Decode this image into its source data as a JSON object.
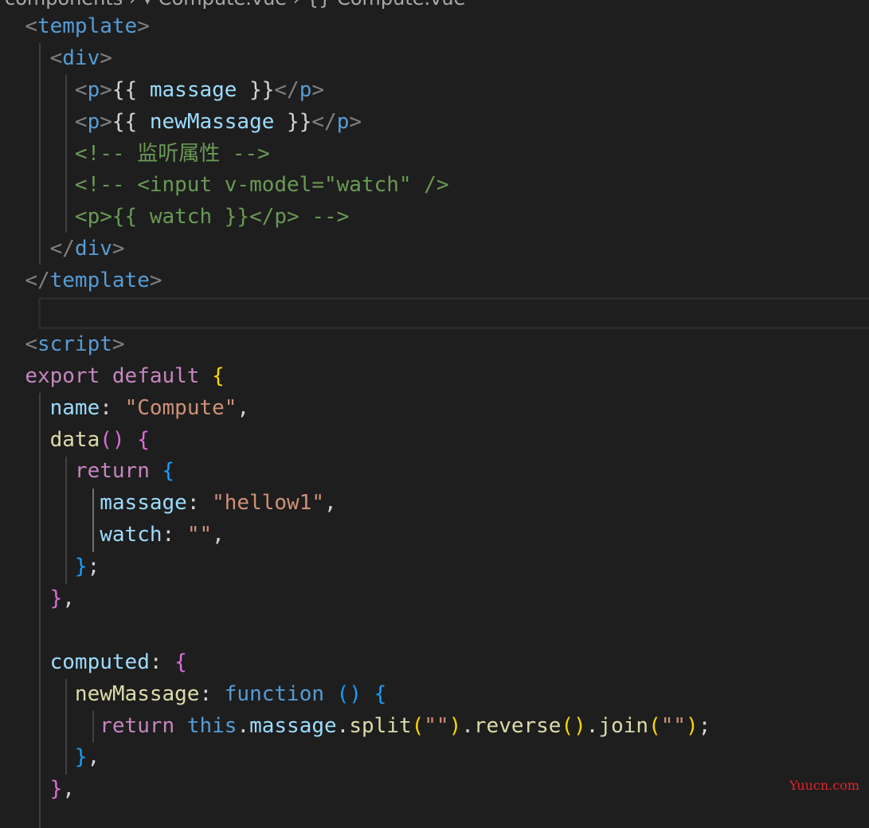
{
  "breadcrumb": {
    "text": "components › ▾ Compute.vue › {} Compute.vue"
  },
  "watermark": "Yuucn.com",
  "colors": {
    "background": "#1e1e1e",
    "tag": "#569cd6",
    "property": "#9cdcfe",
    "comment": "#6a9955",
    "keyword": "#c586c0",
    "string": "#ce9178",
    "function": "#dcdcaa",
    "bracket_gold": "#ffd700",
    "bracket_orchid": "#da70d6",
    "bracket_blue": "#179fff"
  },
  "code": {
    "lines": [
      [
        {
          "t": "  ",
          "c": "text"
        },
        {
          "t": "<",
          "c": "punct"
        },
        {
          "t": "template",
          "c": "tag"
        },
        {
          "t": ">",
          "c": "punct"
        }
      ],
      [
        {
          "t": "    ",
          "c": "text"
        },
        {
          "t": "<",
          "c": "punct"
        },
        {
          "t": "div",
          "c": "tag"
        },
        {
          "t": ">",
          "c": "punct"
        }
      ],
      [
        {
          "t": "      ",
          "c": "text"
        },
        {
          "t": "<",
          "c": "punct"
        },
        {
          "t": "p",
          "c": "tag"
        },
        {
          "t": ">",
          "c": "punct"
        },
        {
          "t": "{{ ",
          "c": "text"
        },
        {
          "t": "massage",
          "c": "var"
        },
        {
          "t": " }}",
          "c": "text"
        },
        {
          "t": "</",
          "c": "punct"
        },
        {
          "t": "p",
          "c": "tag"
        },
        {
          "t": ">",
          "c": "punct"
        }
      ],
      [
        {
          "t": "      ",
          "c": "text"
        },
        {
          "t": "<",
          "c": "punct"
        },
        {
          "t": "p",
          "c": "tag"
        },
        {
          "t": ">",
          "c": "punct"
        },
        {
          "t": "{{ ",
          "c": "text"
        },
        {
          "t": "newMassage",
          "c": "var"
        },
        {
          "t": " }}",
          "c": "text"
        },
        {
          "t": "</",
          "c": "punct"
        },
        {
          "t": "p",
          "c": "tag"
        },
        {
          "t": ">",
          "c": "punct"
        }
      ],
      [
        {
          "t": "      ",
          "c": "text"
        },
        {
          "t": "<!-- 监听属性 -->",
          "c": "cmt"
        }
      ],
      [
        {
          "t": "      ",
          "c": "text"
        },
        {
          "t": "<!-- <input v-model=\"watch\" />",
          "c": "cmt"
        }
      ],
      [
        {
          "t": "      ",
          "c": "text"
        },
        {
          "t": "<p>{{ watch }}</p> -->",
          "c": "cmt"
        }
      ],
      [
        {
          "t": "    ",
          "c": "text"
        },
        {
          "t": "</",
          "c": "punct"
        },
        {
          "t": "div",
          "c": "tag"
        },
        {
          "t": ">",
          "c": "punct"
        }
      ],
      [
        {
          "t": "  ",
          "c": "text"
        },
        {
          "t": "</",
          "c": "punct"
        },
        {
          "t": "template",
          "c": "tag"
        },
        {
          "t": ">",
          "c": "punct"
        }
      ],
      [],
      [
        {
          "t": "  ",
          "c": "text"
        },
        {
          "t": "<",
          "c": "punct"
        },
        {
          "t": "script",
          "c": "tag"
        },
        {
          "t": ">",
          "c": "punct"
        }
      ],
      [
        {
          "t": "  ",
          "c": "text"
        },
        {
          "t": "export",
          "c": "kw"
        },
        {
          "t": " ",
          "c": "text"
        },
        {
          "t": "default",
          "c": "kw"
        },
        {
          "t": " ",
          "c": "text"
        },
        {
          "t": "{",
          "c": "br1"
        }
      ],
      [
        {
          "t": "    ",
          "c": "text"
        },
        {
          "t": "name",
          "c": "var"
        },
        {
          "t": ": ",
          "c": "text"
        },
        {
          "t": "\"Compute\"",
          "c": "str"
        },
        {
          "t": ",",
          "c": "text"
        }
      ],
      [
        {
          "t": "    ",
          "c": "text"
        },
        {
          "t": "data",
          "c": "fn"
        },
        {
          "t": "()",
          "c": "br2"
        },
        {
          "t": " ",
          "c": "text"
        },
        {
          "t": "{",
          "c": "br2"
        }
      ],
      [
        {
          "t": "      ",
          "c": "text"
        },
        {
          "t": "return",
          "c": "kw"
        },
        {
          "t": " ",
          "c": "text"
        },
        {
          "t": "{",
          "c": "br3"
        }
      ],
      [
        {
          "t": "        ",
          "c": "text"
        },
        {
          "t": "massage",
          "c": "var"
        },
        {
          "t": ": ",
          "c": "text"
        },
        {
          "t": "\"hellow1\"",
          "c": "str"
        },
        {
          "t": ",",
          "c": "text"
        }
      ],
      [
        {
          "t": "        ",
          "c": "text"
        },
        {
          "t": "watch",
          "c": "var"
        },
        {
          "t": ": ",
          "c": "text"
        },
        {
          "t": "\"\"",
          "c": "str"
        },
        {
          "t": ",",
          "c": "text"
        }
      ],
      [
        {
          "t": "      ",
          "c": "text"
        },
        {
          "t": "}",
          "c": "br3"
        },
        {
          "t": ";",
          "c": "text"
        }
      ],
      [
        {
          "t": "    ",
          "c": "text"
        },
        {
          "t": "}",
          "c": "br2"
        },
        {
          "t": ",",
          "c": "text"
        }
      ],
      [],
      [
        {
          "t": "    ",
          "c": "text"
        },
        {
          "t": "computed",
          "c": "var"
        },
        {
          "t": ": ",
          "c": "text"
        },
        {
          "t": "{",
          "c": "br2"
        }
      ],
      [
        {
          "t": "      ",
          "c": "text"
        },
        {
          "t": "newMassage",
          "c": "fn"
        },
        {
          "t": ": ",
          "c": "text"
        },
        {
          "t": "function",
          "c": "blue"
        },
        {
          "t": " ",
          "c": "text"
        },
        {
          "t": "()",
          "c": "br3"
        },
        {
          "t": " ",
          "c": "text"
        },
        {
          "t": "{",
          "c": "br3"
        }
      ],
      [
        {
          "t": "        ",
          "c": "text"
        },
        {
          "t": "return",
          "c": "kw"
        },
        {
          "t": " ",
          "c": "text"
        },
        {
          "t": "this",
          "c": "blue"
        },
        {
          "t": ".",
          "c": "text"
        },
        {
          "t": "massage",
          "c": "var"
        },
        {
          "t": ".",
          "c": "text"
        },
        {
          "t": "split",
          "c": "fn"
        },
        {
          "t": "(",
          "c": "br1"
        },
        {
          "t": "\"\"",
          "c": "str"
        },
        {
          "t": ")",
          "c": "br1"
        },
        {
          "t": ".",
          "c": "text"
        },
        {
          "t": "reverse",
          "c": "fn"
        },
        {
          "t": "()",
          "c": "br1"
        },
        {
          "t": ".",
          "c": "text"
        },
        {
          "t": "join",
          "c": "fn"
        },
        {
          "t": "(",
          "c": "br1"
        },
        {
          "t": "\"\"",
          "c": "str"
        },
        {
          "t": ")",
          "c": "br1"
        },
        {
          "t": ";",
          "c": "text"
        }
      ],
      [
        {
          "t": "      ",
          "c": "text"
        },
        {
          "t": "}",
          "c": "br3"
        },
        {
          "t": ",",
          "c": "text"
        }
      ],
      [
        {
          "t": "    ",
          "c": "text"
        },
        {
          "t": "}",
          "c": "br2"
        },
        {
          "t": ",",
          "c": "text"
        }
      ],
      []
    ]
  }
}
